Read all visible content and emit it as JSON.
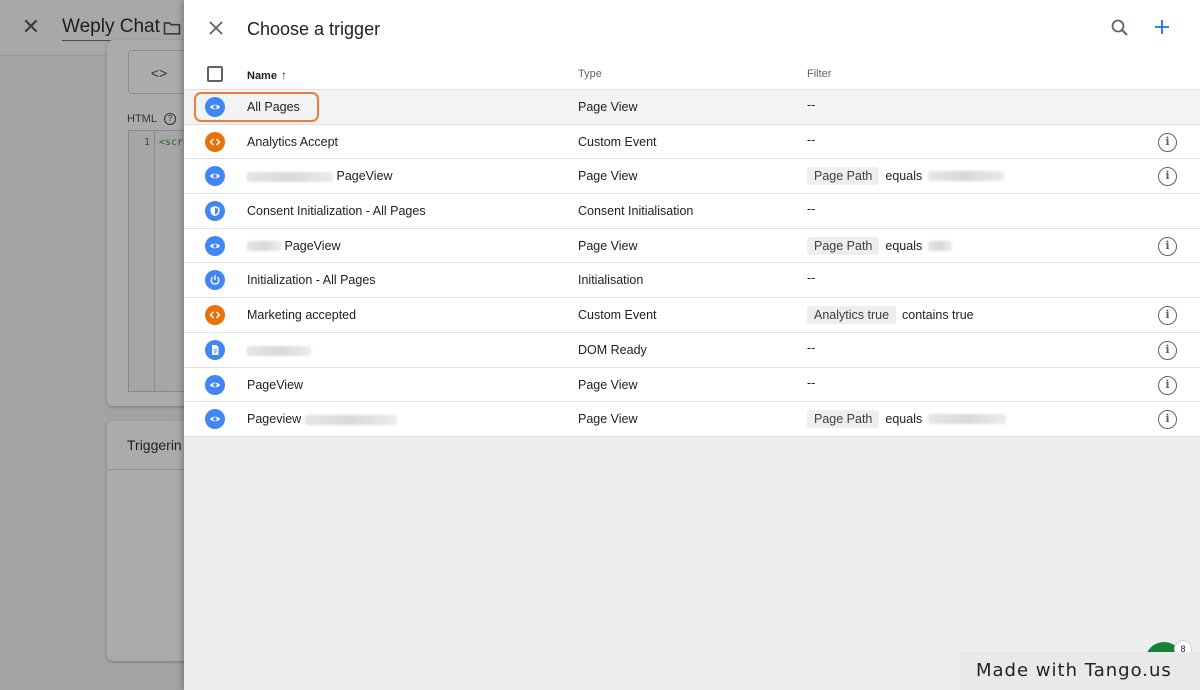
{
  "background": {
    "title": "Weply Chat",
    "code_button_label": "<>",
    "html_label": "HTML",
    "help_icon": "?",
    "line_number": "1",
    "code_snippet": "<scr",
    "triggering_label": "Triggerin"
  },
  "drawer": {
    "title": "Choose a trigger",
    "columns": {
      "name": "Name",
      "sort_indicator": "↑",
      "type": "Type",
      "filter": "Filter"
    },
    "rows": [
      {
        "icon": "eye-icon",
        "color": "blue",
        "name": "All Pages",
        "type": "Page View",
        "filter_text": "--"
      },
      {
        "icon": "code-icon",
        "color": "orange",
        "name": "Analytics Accept",
        "type": "Custom Event",
        "filter_text": "--",
        "info": true
      },
      {
        "icon": "eye-icon",
        "color": "blue",
        "name": "PageView",
        "type": "Page View",
        "filter_chip": "Page Path",
        "filter_op": "equals",
        "info": true
      },
      {
        "icon": "shield-icon",
        "color": "blue",
        "name": "Consent Initialization - All Pages",
        "type": "Consent Initialisation",
        "filter_text": "--"
      },
      {
        "icon": "eye-icon",
        "color": "blue",
        "name": "PageView",
        "type": "Page View",
        "filter_chip": "Page Path",
        "filter_op": "equals",
        "info": true
      },
      {
        "icon": "power-icon",
        "color": "blue",
        "name": "Initialization - All Pages",
        "type": "Initialisation",
        "filter_text": "--"
      },
      {
        "icon": "code-icon",
        "color": "orange",
        "name": "Marketing accepted",
        "type": "Custom Event",
        "filter_chip": "Analytics true",
        "filter_op": "contains true",
        "info": true
      },
      {
        "icon": "document-icon",
        "color": "blue",
        "name": "",
        "type": "DOM Ready",
        "filter_text": "--",
        "info": true
      },
      {
        "icon": "eye-icon",
        "color": "blue",
        "name": "PageView",
        "type": "Page View",
        "filter_text": "--",
        "info": true
      },
      {
        "icon": "eye-icon",
        "color": "blue",
        "name": "Pageview",
        "type": "Page View",
        "filter_chip": "Page Path",
        "filter_op": "equals",
        "info": true
      }
    ],
    "info_glyph": "i"
  },
  "watermark": {
    "text": "Made with Tango.us",
    "badge_count": "8"
  },
  "colors": {
    "accent_blue": "#4285f4",
    "accent_orange": "#e8710a",
    "highlight": "#f07d3a",
    "fab_green": "#188038"
  }
}
